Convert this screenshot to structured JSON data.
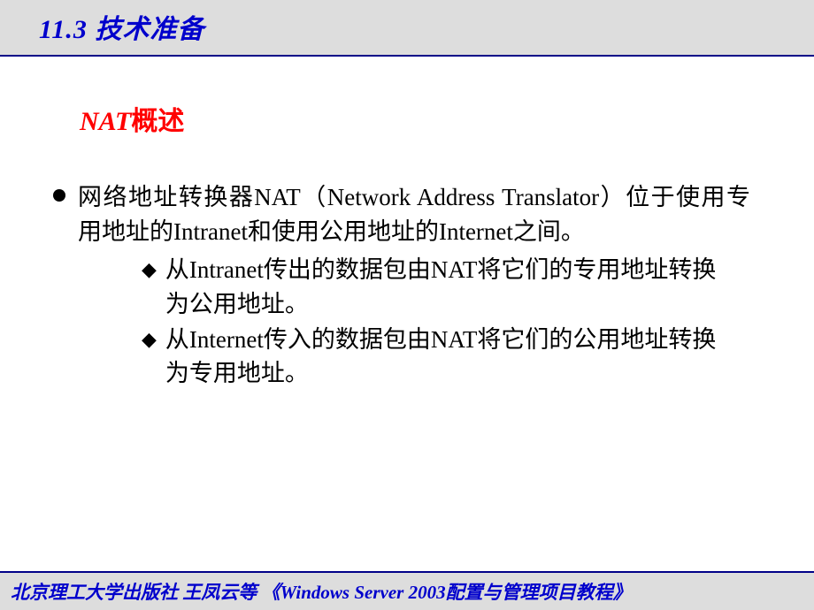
{
  "header": {
    "title": "11.3  技术准备"
  },
  "slide": {
    "subtitle_nat": "NAT",
    "subtitle_rest": "概述",
    "main_bullet": "网络地址转换器NAT（Network  Address Translator）位于使用专用地址的Intranet和使用公用地址的Internet之间。",
    "sub_bullets": [
      "从Intranet传出的数据包由NAT将它们的专用地址转换为公用地址。",
      "从Internet传入的数据包由NAT将它们的公用地址转换为专用地址。"
    ]
  },
  "footer": {
    "text": "北京理工大学出版社   王凤云等 《Windows Server 2003配置与管理项目教程》"
  }
}
